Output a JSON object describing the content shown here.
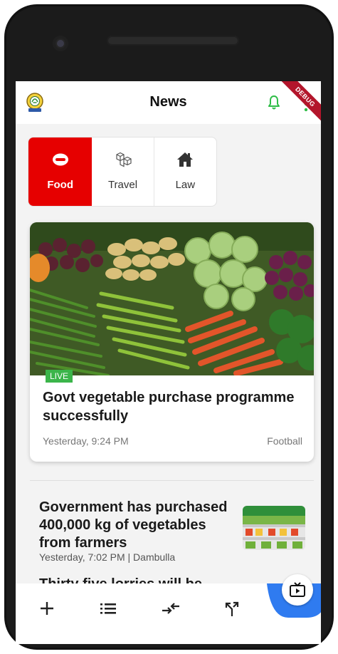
{
  "app": {
    "title": "News",
    "debug_banner": "DEBUG"
  },
  "tabs": [
    {
      "label": "Food",
      "icon": "food-bowl-icon",
      "active": true
    },
    {
      "label": "Travel",
      "icon": "travel-cubes-icon",
      "active": false
    },
    {
      "label": "Law",
      "icon": "home-icon",
      "active": false
    }
  ],
  "featured": {
    "badge": "LIVE",
    "title": "Govt vegetable purchase programme successfully",
    "time": "Yesterday, 9:24 PM",
    "category": "Football"
  },
  "list": [
    {
      "title": "Government has purchased 400,000 kg of vegetables from farmers",
      "meta": "Yesterday, 7:02 PM | Dambulla"
    },
    {
      "title": "Thirty five lorries will be"
    }
  ],
  "bottom_nav": [
    {
      "icon": "add-icon"
    },
    {
      "icon": "list-icon"
    },
    {
      "icon": "compare-arrows-icon"
    },
    {
      "icon": "merge-arrows-icon"
    },
    {
      "icon": "live-tv-icon"
    }
  ],
  "colors": {
    "accent": "#e60000",
    "live": "#3bb54a",
    "bell": "#2ebd47",
    "fab_blue": "#2f7bf0"
  }
}
